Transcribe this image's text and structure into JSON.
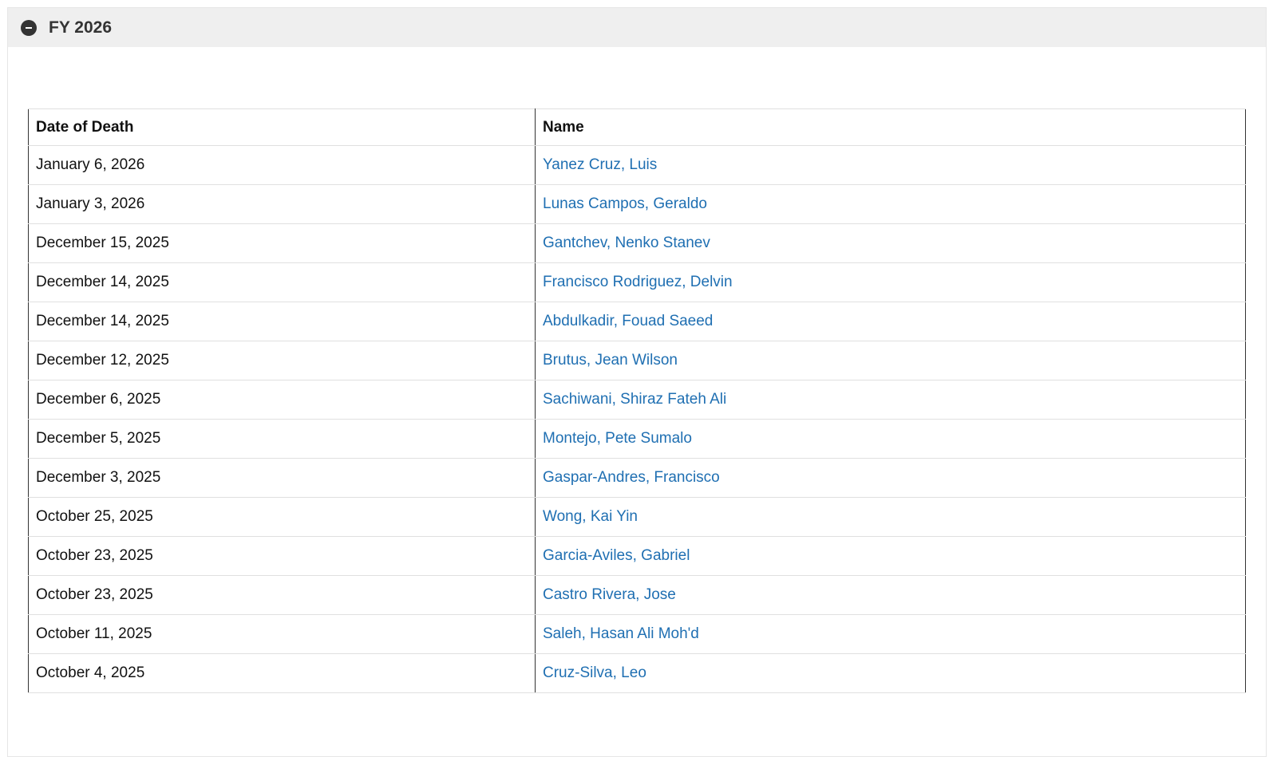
{
  "section": {
    "title": "FY 2026"
  },
  "table": {
    "headers": [
      "Date of Death",
      "Name"
    ],
    "rows": [
      {
        "date": "January 6, 2026",
        "name": "Yanez Cruz, Luis"
      },
      {
        "date": "January 3, 2026",
        "name": "Lunas Campos, Geraldo"
      },
      {
        "date": "December 15, 2025",
        "name": "Gantchev, Nenko Stanev"
      },
      {
        "date": "December 14, 2025",
        "name": "Francisco Rodriguez, Delvin"
      },
      {
        "date": "December 14, 2025",
        "name": "Abdulkadir, Fouad Saeed"
      },
      {
        "date": "December 12, 2025",
        "name": "Brutus, Jean Wilson"
      },
      {
        "date": "December 6, 2025",
        "name": "Sachiwani, Shiraz Fateh Ali"
      },
      {
        "date": "December 5, 2025",
        "name": "Montejo, Pete Sumalo"
      },
      {
        "date": "December 3, 2025",
        "name": "Gaspar-Andres, Francisco"
      },
      {
        "date": "October 25, 2025",
        "name": "Wong, Kai Yin"
      },
      {
        "date": "October 23, 2025",
        "name": "Garcia-Aviles, Gabriel"
      },
      {
        "date": "October 23, 2025",
        "name": "Castro Rivera, Jose"
      },
      {
        "date": "October 11, 2025",
        "name": "Saleh, Hasan Ali Moh'd"
      },
      {
        "date": "October 4, 2025",
        "name": "Cruz-Silva, Leo"
      }
    ]
  },
  "colors": {
    "link": "#1f6fb2",
    "header_bg": "#efefef",
    "toggle_icon": "#333333"
  },
  "icons": {
    "toggle": "minus-circle-icon"
  }
}
